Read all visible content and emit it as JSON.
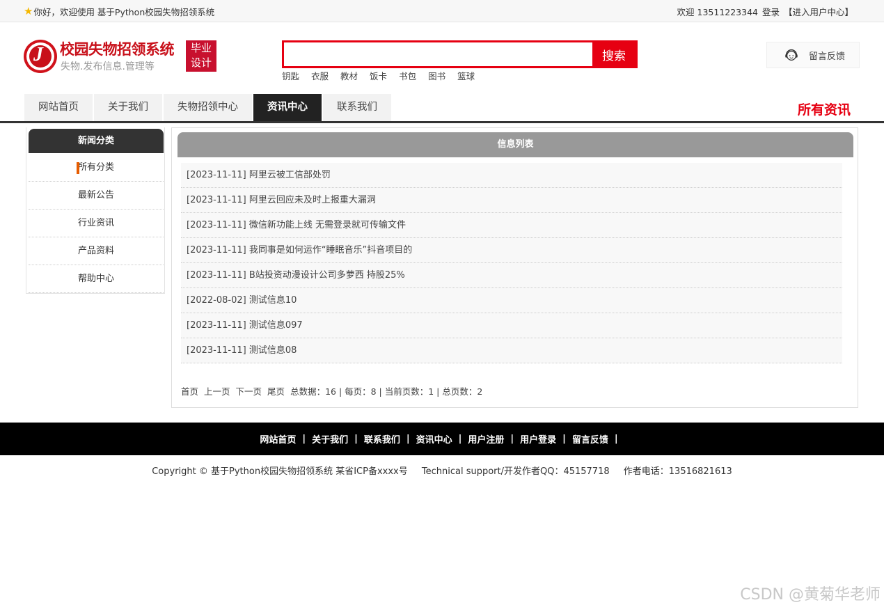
{
  "topbar": {
    "welcome": "你好，欢迎使用 基于Python校园失物招领系统",
    "user_greeting": "欢迎 13511223344",
    "login_label": "登录",
    "user_center_label": "【进入用户中心】"
  },
  "logo": {
    "title": "校园失物招领系统",
    "subtitle": "失物.发布信息.管理等",
    "badge_line1": "毕业",
    "badge_line2": "设计"
  },
  "search": {
    "placeholder": "",
    "button_label": "搜索",
    "hotwords": [
      "钥匙",
      "衣服",
      "教材",
      "饭卡",
      "书包",
      "图书",
      "篮球"
    ]
  },
  "feedback": {
    "label": "留言反馈"
  },
  "nav": {
    "tabs": [
      "网站首页",
      "关于我们",
      "失物招领中心",
      "资讯中心",
      "联系我们"
    ],
    "active_index": 3,
    "current_section": "所有资讯"
  },
  "sidebar": {
    "title": "新闻分类",
    "items": [
      "所有分类",
      "最新公告",
      "行业资讯",
      "产品资料",
      "帮助中心"
    ],
    "active_index": 0
  },
  "main": {
    "title": "信息列表",
    "items": [
      "[2023-11-11] 阿里云被工信部处罚",
      "[2023-11-11] 阿里云回应未及时上报重大漏洞",
      "[2023-11-11] 微信新功能上线 无需登录就可传输文件",
      "[2023-11-11] 我同事是如何运作“睡眠音乐”抖音项目的",
      "[2023-11-11] B站投资动漫设计公司多萝西 持股25%",
      "[2022-08-02] 测试信息10",
      "[2023-11-11] 测试信息097",
      "[2023-11-11] 测试信息08"
    ],
    "pager": {
      "first": "首页",
      "prev": "上一页",
      "next": "下一页",
      "last": "尾页",
      "info": "总数据：16 | 每页：8 | 当前页数：1 | 总页数：2"
    }
  },
  "footer": {
    "links": [
      "网站首页",
      "关于我们",
      "联系我们",
      "资讯中心",
      "用户注册",
      "用户登录",
      "留言反馈"
    ],
    "sep": "|",
    "copyright": "Copyright © 基于Python校园失物招领系统 某省ICP备xxxx号",
    "support": "Technical support/开发作者QQ：45157718",
    "phone": "作者电话：13516821613"
  },
  "watermark": "CSDN @黄菊华老师"
}
